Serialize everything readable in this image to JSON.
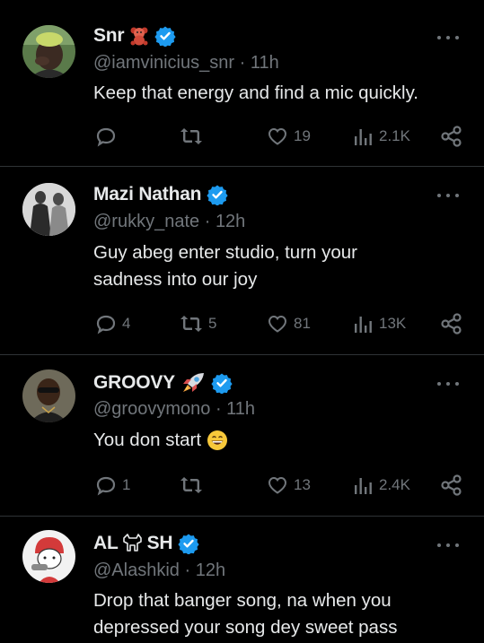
{
  "tweets": [
    {
      "name": "Snr",
      "emoji": "teddy-bear",
      "handle": "@iamvinicius_snr",
      "dot": "·",
      "time": "11h",
      "lines": [
        "Keep that energy and find a mic quickly."
      ],
      "stats": {
        "replies": "",
        "retweets": "",
        "likes": "19",
        "views": "2.1K"
      }
    },
    {
      "name": "Mazi Nathan",
      "emoji": "",
      "handle": "@rukky_nate",
      "dot": "·",
      "time": "12h",
      "lines": [
        "Guy abeg enter studio, turn your",
        "sadness into our joy"
      ],
      "stats": {
        "replies": "4",
        "retweets": "5",
        "likes": "81",
        "views": "13K"
      }
    },
    {
      "name": "GROOVY",
      "emoji": "rocket",
      "handle": "@groovymono",
      "dot": "·",
      "time": "11h",
      "lines": [
        "You don start"
      ],
      "lines_emoji": "grinning-face",
      "stats": {
        "replies": "1",
        "retweets": "",
        "likes": "13",
        "views": "2.4K"
      }
    },
    {
      "name_a": "AL",
      "name_b": "SH",
      "name_glyph": "dog-glyph",
      "handle": "@Alashkid",
      "dot": "·",
      "time": "12h",
      "lines": [
        "Drop that banger song, na when you",
        "depressed your song dey sweet pass"
      ]
    }
  ],
  "colors": {
    "background": "#000000",
    "text": "#e7e9ea",
    "muted": "#71767b",
    "verified": "#1d9bf0",
    "divider": "#2f3336"
  }
}
